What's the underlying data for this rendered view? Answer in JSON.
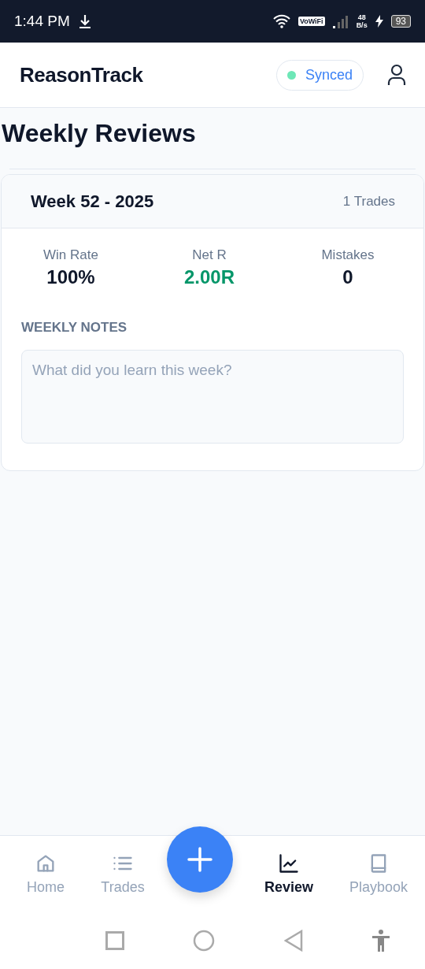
{
  "status_bar": {
    "time": "1:44 PM",
    "network_badge": "VoWiFi",
    "speed_value": "48",
    "speed_unit": "B/s",
    "battery": "93"
  },
  "header": {
    "title": "ReasonTrack",
    "sync": {
      "label": "Synced",
      "on": true
    }
  },
  "page_title": "Weekly Reviews",
  "week_card": {
    "title": "Week 52 - 2025",
    "trade_count": "1 Trades",
    "stats": [
      {
        "label": "Win Rate",
        "value": "100%",
        "color": "#0f172a"
      },
      {
        "label": "Net R",
        "value": "2.00R",
        "color": "#059669"
      },
      {
        "label": "Mistakes",
        "value": "0",
        "color": "#0f172a"
      }
    ],
    "notes_label": "WEEKLY NOTES",
    "notes": {
      "placeholder": "What did you learn this week?"
    }
  },
  "bottom_nav": [
    {
      "kind": "home",
      "label": "Home",
      "selected": false
    },
    {
      "kind": "trades",
      "label": "Trades",
      "selected": false
    },
    {
      "kind": "add",
      "selected": false
    },
    {
      "kind": "review",
      "label": "Review",
      "selected": true
    },
    {
      "kind": "playbook",
      "label": "Playbook",
      "selected": false
    }
  ]
}
